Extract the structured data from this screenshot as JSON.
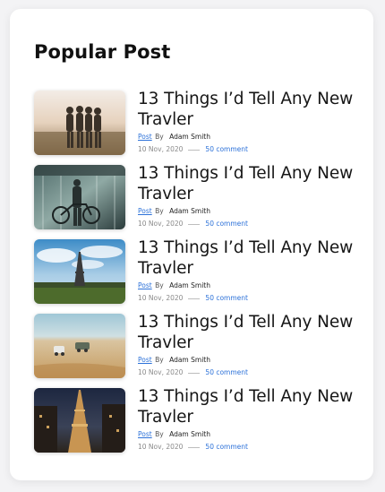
{
  "widget": {
    "title": "Popular Post"
  },
  "posts": [
    {
      "title": "13 Things I’d Tell Any New Travler",
      "category": "Post",
      "by_label": "By",
      "author": "Adam Smith",
      "date": "10 Nov, 2020",
      "comments": "50 comment",
      "image": "friends-hugging-sunset"
    },
    {
      "title": "13 Things I’d Tell Any New Travler",
      "category": "Post",
      "by_label": "By",
      "author": "Adam Smith",
      "date": "10 Nov, 2020",
      "comments": "50 comment",
      "image": "man-with-bicycle-station"
    },
    {
      "title": "13 Things I’d Tell Any New Travler",
      "category": "Post",
      "by_label": "By",
      "author": "Adam Smith",
      "date": "10 Nov, 2020",
      "comments": "50 comment",
      "image": "eiffel-tower-park"
    },
    {
      "title": "13 Things I’d Tell Any New Travler",
      "category": "Post",
      "by_label": "By",
      "author": "Adam Smith",
      "date": "10 Nov, 2020",
      "comments": "50 comment",
      "image": "desert-vehicles"
    },
    {
      "title": "13 Things I’d Tell Any New Travler",
      "category": "Post",
      "by_label": "By",
      "author": "Adam Smith",
      "date": "10 Nov, 2020",
      "comments": "50 comment",
      "image": "eiffel-tower-night"
    }
  ],
  "colors": {
    "link": "#2d72d9",
    "title": "#161616",
    "muted": "#8a8a8a"
  }
}
